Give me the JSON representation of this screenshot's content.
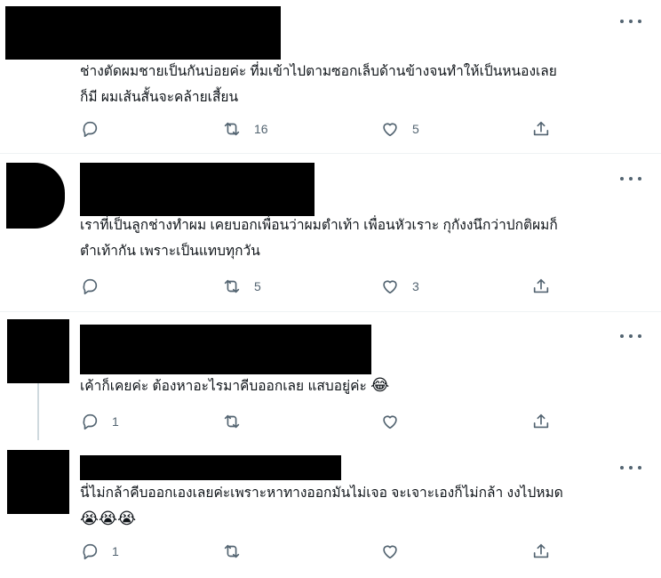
{
  "tweets": [
    {
      "text_lines": [
        "ช่างตัดผมชายเป็นกันบ่อยค่ะ  ที่มเข้าไปตามซอกเล็บด้านข้างจนทำให้เป็นหนองเลย",
        "ก็มี ผมเส้นสั้นจะคล้ายเสี้ยน"
      ],
      "emoji": "",
      "reply_count": "",
      "retweet_count": "16",
      "like_count": "5"
    },
    {
      "text_lines": [
        "เราที่เป็นลูกช่างทำผม เคยบอกเพื่อนว่าผมตำเท้า เพื่อนหัวเราะ  กุกังงนึกว่าปกติผมก็",
        "ตำเท้ากัน เพราะเป็นแทบทุกวัน"
      ],
      "emoji": "",
      "reply_count": "",
      "retweet_count": "5",
      "like_count": "3"
    },
    {
      "text_lines": [
        "เค้าก็เคยค่ะ ต้องหาอะไรมาคีบออกเลย แสบอยู่ค่ะ"
      ],
      "emoji": "😂",
      "reply_count": "1",
      "retweet_count": "",
      "like_count": ""
    },
    {
      "text_lines": [
        "นี่ไม่กล้าคีบออกเองเลยค่ะเพราะหาทางออกมันไม่เจอ จะเจาะเองก็ไม่กล้า งงไปหมด"
      ],
      "emoji": "😭😭😭",
      "reply_count": "1",
      "retweet_count": "",
      "like_count": ""
    }
  ],
  "icons": {
    "reply": "reply-icon",
    "retweet": "retweet-icon",
    "like": "heart-icon",
    "share": "share-icon",
    "more": "more-icon"
  },
  "colors": {
    "icon_gray": "#536471",
    "text": "#0f1419",
    "divider": "#eff3f4",
    "thread_line": "#cfd9de",
    "redaction": "#000000"
  }
}
